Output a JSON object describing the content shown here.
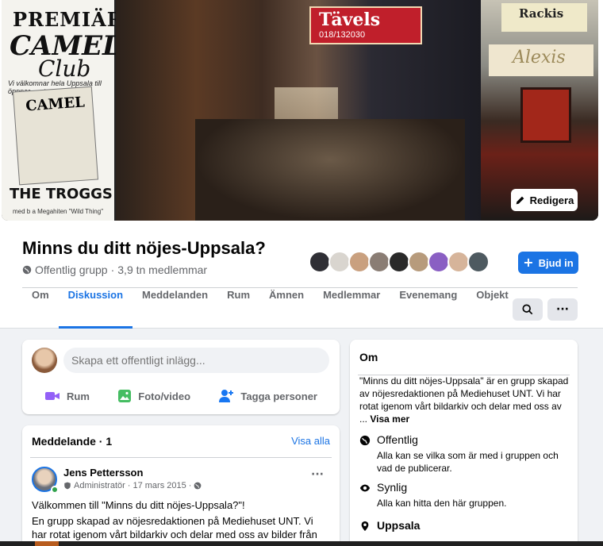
{
  "cover": {
    "poster_texts": [
      "PREMIÄR",
      "CAMEL",
      "Club",
      "Vi välkomnar hela Uppsala till öppnar ... stora",
      "CAMEL",
      "THE TROGGS",
      "med b a Megahiten \"Wild Thing\""
    ],
    "street_sign": "Tävels",
    "street_sign_phone": "018/132030",
    "right_signs": [
      "Rackis",
      "Alexis"
    ],
    "edit_label": "Redigera"
  },
  "group": {
    "title": "Minns du ditt nöjes-Uppsala?",
    "privacy": "Offentlig grupp",
    "separator": " · ",
    "members": "3,9 tn medlemmar",
    "join_label": "Bjud in",
    "member_avatar_colors": [
      "#2f2f35",
      "#d9d5cf",
      "#c9a07f",
      "#8a7d74",
      "#2a2a2a",
      "#b79b7c",
      "#8a5fc3",
      "#d6b49a",
      "#4e5a60"
    ]
  },
  "tabs": [
    "Om",
    "Diskussion",
    "Meddelanden",
    "Rum",
    "Ämnen",
    "Medlemmar",
    "Evenemang",
    "Objekt"
  ],
  "active_tab": "Diskussion",
  "composer": {
    "placeholder": "Skapa ett offentligt inlägg...",
    "actions": [
      {
        "label": "Rum",
        "icon": "video-room-icon",
        "color": "#9360f7"
      },
      {
        "label": "Foto/video",
        "icon": "photo-icon",
        "color": "#45bd62"
      },
      {
        "label": "Tagga personer",
        "icon": "tag-people-icon",
        "color": "#1877f2"
      }
    ]
  },
  "announcements": {
    "title": "Meddelande · 1",
    "see_all": "Visa alla",
    "post": {
      "author": "Jens Pettersson",
      "role": "Administratör",
      "date": "17 mars 2015",
      "p1": "Välkommen till \"Minns du ditt nöjes-Uppsala?\"!",
      "p2": "En grupp skapad av nöjesredaktionen på Mediehuset UNT. Vi har rotat igenom vårt bildarkiv och delar med oss av bilder från förr. För visst är"
    }
  },
  "about": {
    "title": "Om",
    "description": "\"Minns du ditt nöjes-Uppsala\" är en grupp skapad av nöjesredaktionen på Mediehuset UNT. Vi har rotat igenom vårt bildarkiv och delar med oss av ...",
    "see_more": "Visa mer",
    "items": [
      {
        "title": "Offentlig",
        "desc": "Alla kan se vilka som är med i gruppen och vad de publicerar.",
        "icon": "globe-icon"
      },
      {
        "title": "Synlig",
        "desc": "Alla kan hitta den här gruppen.",
        "icon": "eye-icon"
      },
      {
        "title": "Uppsala",
        "desc": "",
        "icon": "location-pin-icon"
      }
    ]
  },
  "colors": {
    "accent": "#1b74e4",
    "background": "#f0f2f5",
    "secondary_text": "#65676b"
  }
}
